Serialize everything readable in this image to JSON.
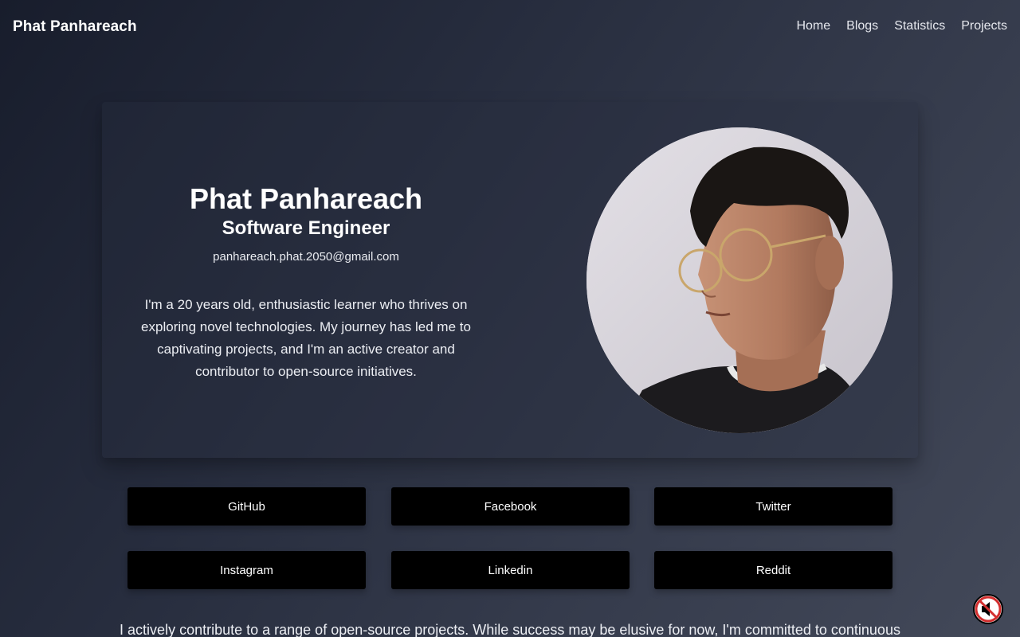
{
  "nav": {
    "brand": "Phat Panhareach",
    "links": [
      "Home",
      "Blogs",
      "Statistics",
      "Projects"
    ]
  },
  "hero": {
    "name": "Phat Panhareach",
    "role": "Software Engineer",
    "email": "panhareach.phat.2050@gmail.com",
    "bio": "I'm a 20 years old, enthusiastic learner who thrives on exploring novel technologies. My journey has led me to captivating projects, and I'm an active creator and contributor to open-source initiatives."
  },
  "social": [
    "GitHub",
    "Facebook",
    "Twitter",
    "Instagram",
    "Linkedin",
    "Reddit"
  ],
  "footer": {
    "text": "I actively contribute to a range of open-source projects. While success may be elusive for now, I'm committed to continuous"
  },
  "icons": {
    "avatar": "profile-photo",
    "mute": "speaker-muted-icon"
  },
  "colors": {
    "button_bg": "#000000",
    "mute_ring": "#d32f2f"
  }
}
